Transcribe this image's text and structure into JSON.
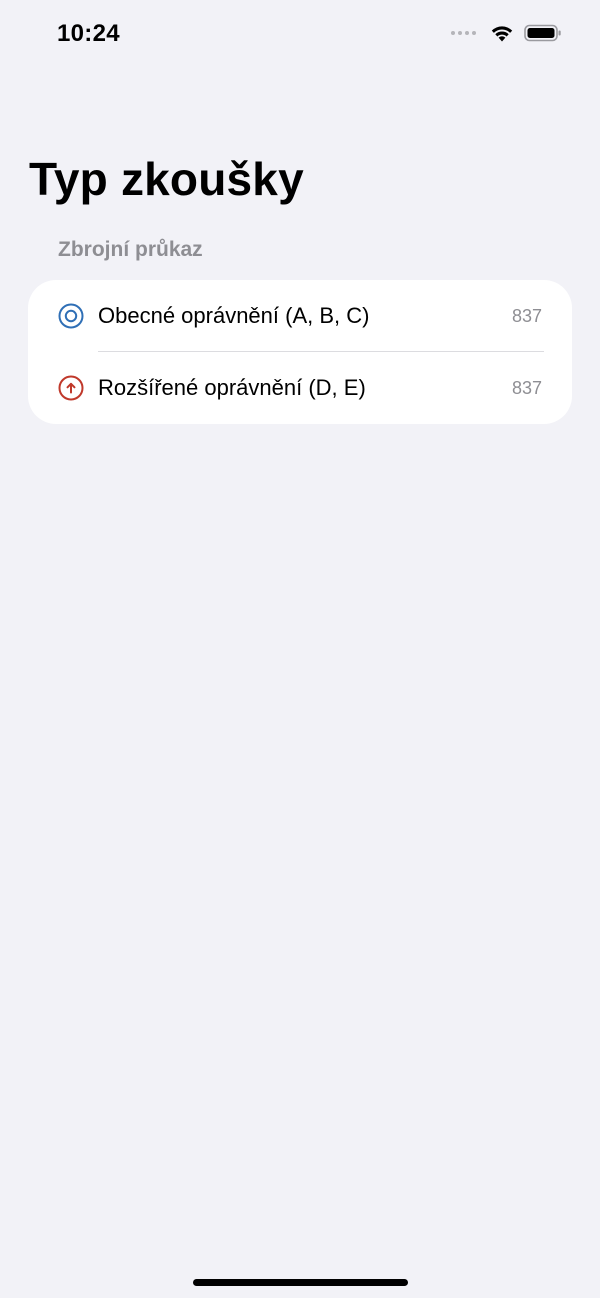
{
  "status_bar": {
    "time": "10:24"
  },
  "page": {
    "title": "Typ zkoušky"
  },
  "section": {
    "header": "Zbrojní průkaz",
    "items": [
      {
        "label": "Obecné oprávnění (A, B, C)",
        "count": "837",
        "icon": "target-circle-icon",
        "icon_color": "#2f6fb6"
      },
      {
        "label": "Rozšířené oprávnění (D, E)",
        "count": "837",
        "icon": "arrow-up-circle-icon",
        "icon_color": "#c0392b"
      }
    ]
  },
  "colors": {
    "background": "#f2f2f7",
    "card": "#ffffff",
    "secondary_text": "#8e8e93"
  }
}
